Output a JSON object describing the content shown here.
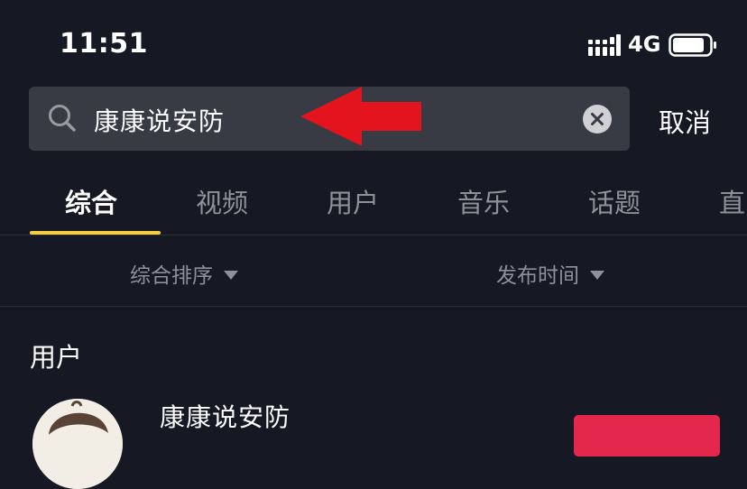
{
  "status_bar": {
    "time": "11:51",
    "network": "4G",
    "icons": [
      "signal-icon",
      "battery-icon"
    ]
  },
  "search": {
    "value": "康康说安防",
    "cancel_label": "取消",
    "icons": [
      "search-icon",
      "clear-icon",
      "red-arrow-icon"
    ]
  },
  "tabs": [
    {
      "label": "综合",
      "active": true
    },
    {
      "label": "视频",
      "active": false
    },
    {
      "label": "用户",
      "active": false
    },
    {
      "label": "音乐",
      "active": false
    },
    {
      "label": "话题",
      "active": false
    },
    {
      "label": "直",
      "active": false
    }
  ],
  "filters": {
    "sort_label": "综合排序",
    "time_label": "发布时间"
  },
  "users_section": {
    "title": "用户",
    "items": [
      {
        "name": "康康说安防"
      }
    ]
  },
  "colors": {
    "background": "#161823",
    "search_box": "#393b44",
    "tab_indicator": "#f4cd45",
    "annotation_arrow": "#e3141d",
    "follow_button": "#e3274d",
    "muted_text": "#8f9099"
  }
}
